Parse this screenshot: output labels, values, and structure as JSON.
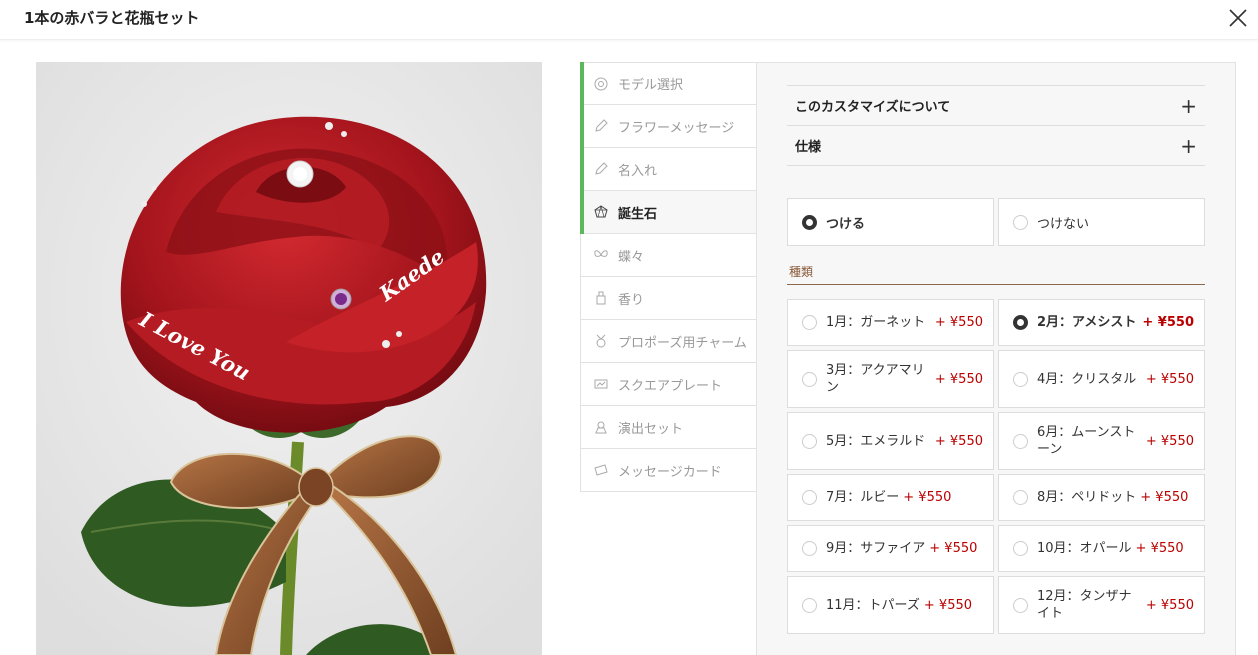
{
  "header": {
    "title": "1本の赤バラと花瓶セット"
  },
  "nav": {
    "items": [
      {
        "label": "モデル選択",
        "icon": "model-icon",
        "state": "done"
      },
      {
        "label": "フラワーメッセージ",
        "icon": "pen-icon",
        "state": "done"
      },
      {
        "label": "名入れ",
        "icon": "pen-icon",
        "state": "done"
      },
      {
        "label": "誕生石",
        "icon": "gem-icon",
        "state": "active"
      },
      {
        "label": "蝶々",
        "icon": "butterfly-icon",
        "state": ""
      },
      {
        "label": "香り",
        "icon": "perfume-icon",
        "state": ""
      },
      {
        "label": "プロポーズ用チャーム",
        "icon": "charm-icon",
        "state": ""
      },
      {
        "label": "スクエアプレート",
        "icon": "plate-icon",
        "state": ""
      },
      {
        "label": "演出セット",
        "icon": "set-icon",
        "state": ""
      },
      {
        "label": "メッセージカード",
        "icon": "card-icon",
        "state": ""
      }
    ]
  },
  "accordion": {
    "about": "このカスタマイズについて",
    "spec": "仕様",
    "plus": "+"
  },
  "attach": {
    "on_label": "つける",
    "off_label": "つけない"
  },
  "type_section": {
    "label": "種類"
  },
  "stones": [
    {
      "label": "1月：ガーネット",
      "price": "+ ¥550",
      "selected": false
    },
    {
      "label": "2月：アメシスト",
      "price": "+ ¥550",
      "selected": true
    },
    {
      "label": "3月：アクアマリン",
      "price": "+ ¥550",
      "selected": false
    },
    {
      "label": "4月：クリスタル",
      "price": "+ ¥550",
      "selected": false
    },
    {
      "label": "5月：エメラルド",
      "price": "+ ¥550",
      "selected": false
    },
    {
      "label": "6月：ムーンストーン",
      "price": "+ ¥550",
      "selected": false
    },
    {
      "label": "7月：ルビー",
      "price": "+ ¥550",
      "selected": false
    },
    {
      "label": "8月：ペリドット",
      "price": "+ ¥550",
      "selected": false
    },
    {
      "label": "9月：サファイア",
      "price": "+ ¥550",
      "selected": false
    },
    {
      "label": "10月：オパール",
      "price": "+ ¥550",
      "selected": false
    },
    {
      "label": "11月：トパーズ",
      "price": "+ ¥550",
      "selected": false
    },
    {
      "label": "12月：タンザナイト",
      "price": "+ ¥550",
      "selected": false
    }
  ],
  "product_image": {
    "engraving_left": "I Love You",
    "engraving_right": "Kaede"
  },
  "colors": {
    "accent_green": "#5cb85c",
    "price_red": "#bb0000",
    "rose_red": "#a4141c",
    "ribbon_brown": "#8a5230"
  }
}
